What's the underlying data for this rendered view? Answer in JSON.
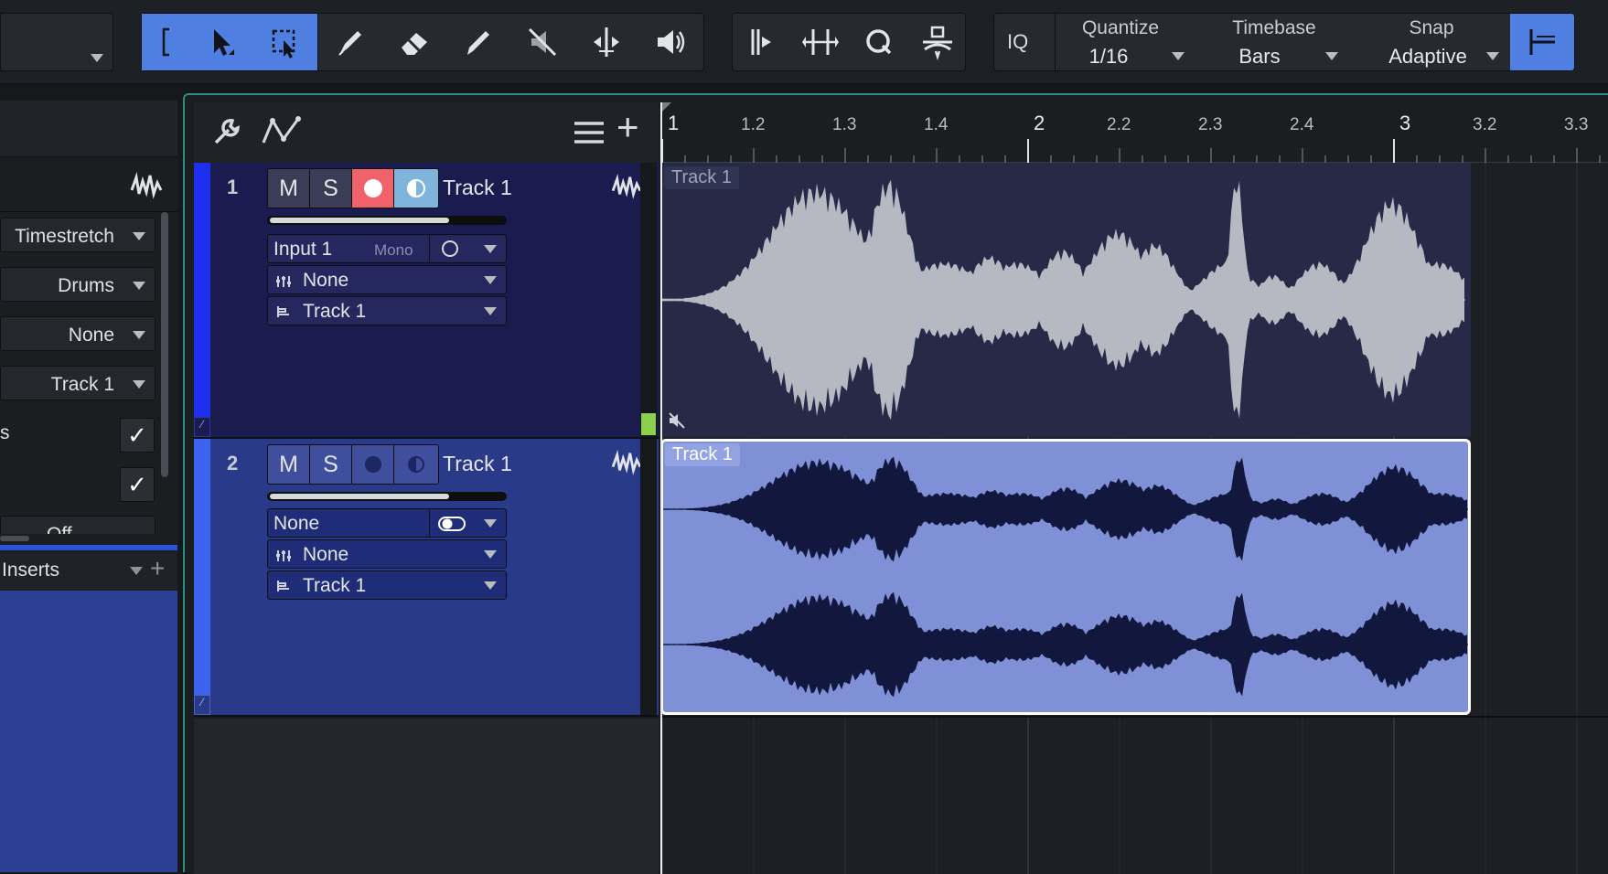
{
  "toolbar": {
    "tools": [
      "range-bracket-icon",
      "arrow-tool-icon",
      "range-tool-icon",
      "split-tool-icon",
      "eraser-tool-icon",
      "paint-tool-icon",
      "mute-tool-icon",
      "bend-tool-icon",
      "listen-tool-icon"
    ],
    "iq_label": "IQ",
    "quantize": {
      "label": "Quantize",
      "value": "1/16"
    },
    "timebase": {
      "label": "Timebase",
      "value": "Bars"
    },
    "snap": {
      "label": "Snap",
      "value": "Adaptive"
    },
    "accent": "#4f7fe0"
  },
  "inspector": {
    "rows": [
      "Timestretch",
      "Drums",
      "None",
      "Track 1"
    ],
    "check_label": "s",
    "cut_row": "Off",
    "inserts_label": "Inserts"
  },
  "ruler": {
    "labels": [
      "1",
      "1.2",
      "1.3",
      "1.4",
      "2",
      "2.2",
      "2.3",
      "2.4",
      "3",
      "3.2",
      "3.3"
    ]
  },
  "tracks": [
    {
      "number": "1",
      "mute": "M",
      "solo": "S",
      "name": "Track 1",
      "input": "Input 1",
      "input_mode": "Mono",
      "instrument": "None",
      "output": "Track 1",
      "event_name": "Track 1",
      "color": "#1a1b50"
    },
    {
      "number": "2",
      "mute": "M",
      "solo": "S",
      "name": "Track 1",
      "input": "None",
      "instrument": "None",
      "output": "Track 1",
      "event_name": "Track 1",
      "color": "#2a3a8a"
    }
  ]
}
